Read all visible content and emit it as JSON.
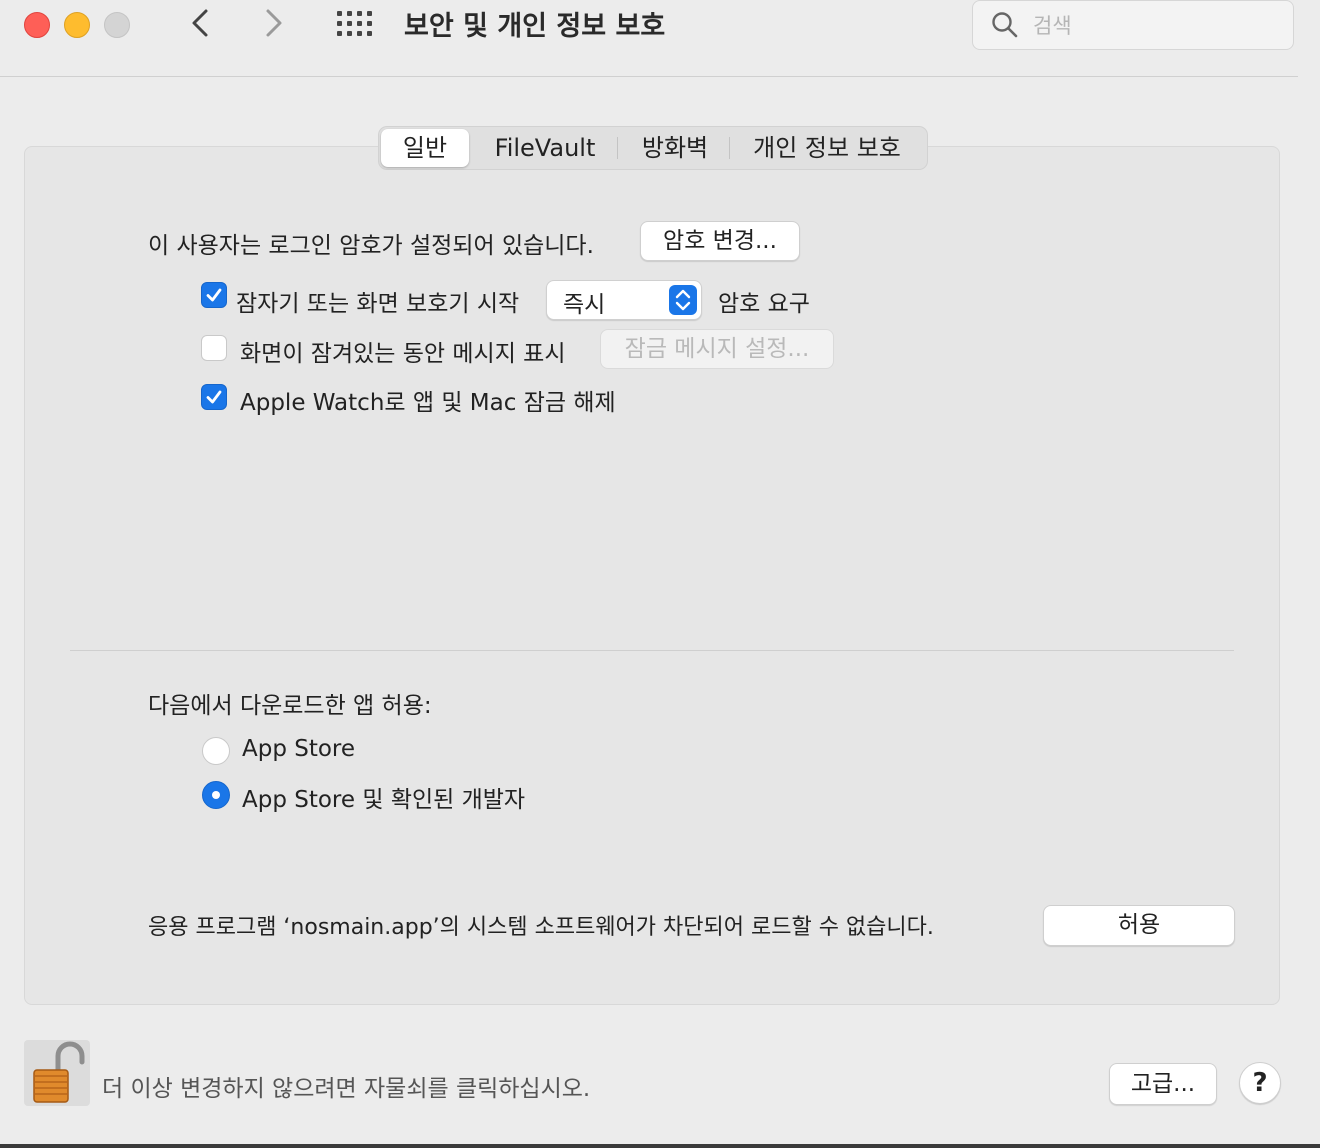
{
  "window": {
    "title": "보안 및 개인 정보 보호",
    "search_placeholder": "검색"
  },
  "tabs": [
    {
      "label": "일반",
      "active": true
    },
    {
      "label": "FileVault",
      "active": false
    },
    {
      "label": "방화벽",
      "active": false
    },
    {
      "label": "개인 정보 보호",
      "active": false
    }
  ],
  "general": {
    "password_status": "이 사용자는 로그인 암호가 설정되어 있습니다.",
    "change_password_button": "암호 변경...",
    "require_password": {
      "checked": true,
      "label": "잠자기 또는 화면 보호기 시작",
      "select_value": "즉시",
      "suffix": "암호 요구"
    },
    "show_message": {
      "checked": false,
      "label": "화면이 잠겨있는 동안 메시지 표시",
      "button": "잠금 메시지 설정..."
    },
    "apple_watch": {
      "checked": true,
      "label": "Apple Watch로 앱 및 Mac 잠금 해제"
    }
  },
  "downloads": {
    "heading": "다음에서 다운로드한 앱 허용:",
    "options": [
      {
        "label": "App Store",
        "selected": false
      },
      {
        "label": "App Store 및 확인된 개발자",
        "selected": true
      }
    ]
  },
  "blocked": {
    "message": "응용 프로그램 ‘nosmain.app’의 시스템 소프트웨어가 차단되어 로드할 수 없습니다.",
    "allow_button": "허용"
  },
  "footer": {
    "lock_message": "더 이상 변경하지 않으려면 자물쇠를 클릭하십시오.",
    "advanced_button": "고급...",
    "help_label": "?"
  },
  "colors": {
    "accent": "#1a76e8",
    "close": "#fe5f57",
    "minimize": "#febc2e"
  },
  "icons": [
    "back-chevron-icon",
    "forward-chevron-icon",
    "grid-icon",
    "search-icon",
    "checkmark-icon",
    "stepper-icon",
    "unlocked-padlock-icon"
  ]
}
